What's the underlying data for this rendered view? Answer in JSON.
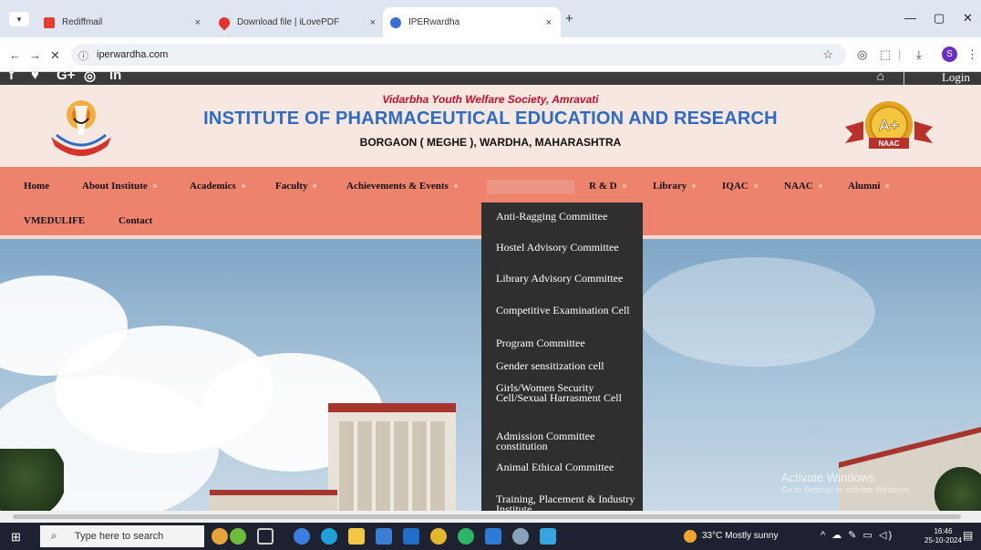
{
  "browser": {
    "tab_menu_icon": "chevron-down-icon",
    "tabs": [
      {
        "title": "Rediffmail",
        "favicon_color": "#e43d30"
      },
      {
        "title": "Download file | iLovePDF",
        "favicon_color": "#e5322d"
      },
      {
        "title": "IPERwardha",
        "favicon_color": "#3a6fd8"
      }
    ],
    "close_glyph": "×",
    "new_tab_glyph": "+",
    "url": "iperwardha.com",
    "profile_initial": "S"
  },
  "site": {
    "top_bar": {
      "login": "Login"
    },
    "header": {
      "society": "Vidarbha Youth Welfare Society, Amravati",
      "institute": "INSTITUTE OF PHARMACEUTICAL EDUCATION AND RESEARCH",
      "address": "BORGAON ( MEGHE ), WARDHA, MAHARASHTRA",
      "accreditation": {
        "grade": "A+",
        "body": "NAAC"
      }
    },
    "nav": [
      "Home",
      "About Institute",
      "Academics",
      "Faculty",
      "Achievements & Events",
      "",
      "R & D",
      "Library",
      "IQAC",
      "NAAC",
      "Alumni",
      "VMEDULIFE",
      "Contact"
    ],
    "dropdown": [
      "Anti-Ragging Committee",
      "Hostel Advisory Committee",
      "Library Advisory Committee",
      "Competitive Examination Cell",
      "Program Committee",
      "Gender sensitization cell",
      "Girls/Women Security Cell/Sexual Harrasment Cell",
      "Admission Committee constitution",
      "Animal Ethical Committee",
      "Training, Placement & Industry Institute"
    ],
    "watermark": {
      "line1": "Activate Windows",
      "line2": "Go to Settings to activate Windows."
    }
  },
  "taskbar": {
    "search_placeholder": "Type here to search",
    "weather": "33°C  Mostly sunny",
    "time": "16:46",
    "date": "25-10-2024"
  },
  "colors": {
    "nav_bg": "#ee836d",
    "header_bg": "#f6e8e1",
    "title_blue": "#2d6bc4",
    "society_red": "#c8102e",
    "dropdown_bg": "#2f2f2f"
  }
}
